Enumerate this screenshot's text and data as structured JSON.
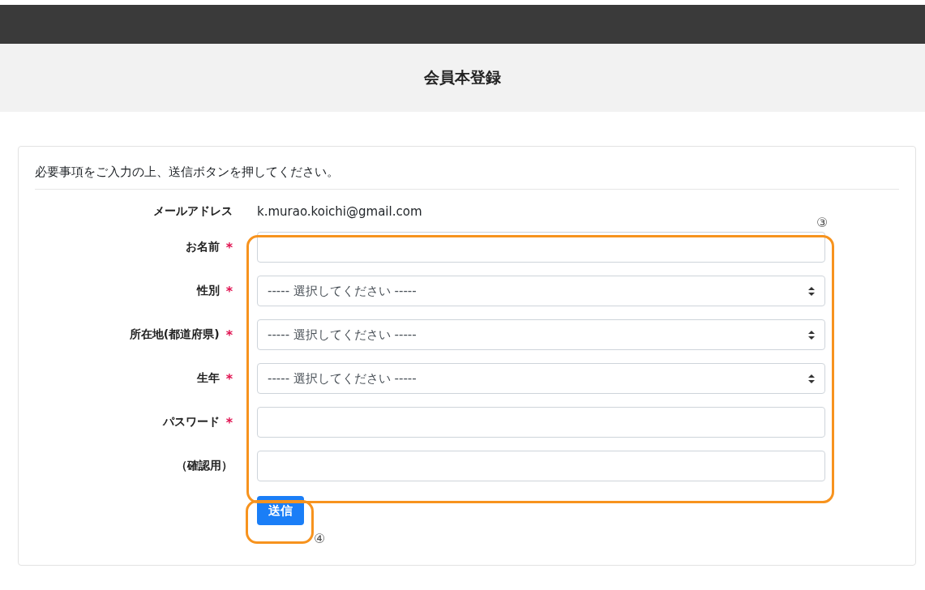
{
  "header": {
    "title": "会員本登録"
  },
  "form": {
    "intro": "必要事項をご入力の上、送信ボタンを押してください。",
    "email": {
      "label": "メールアドレス",
      "value": "k.murao.koichi@gmail.com"
    },
    "fields": [
      {
        "label": "お名前",
        "mark": "*",
        "kind": "input"
      },
      {
        "label": "性別",
        "mark": "*",
        "kind": "select",
        "value": "----- 選択してください -----"
      },
      {
        "label": "所在地(都道府県)",
        "mark": "*",
        "kind": "select",
        "value": "----- 選択してください -----"
      },
      {
        "label": "生年",
        "mark": "*",
        "kind": "select",
        "value": "----- 選択してください -----"
      },
      {
        "label": "パスワード",
        "mark": "*",
        "kind": "input"
      },
      {
        "label": "（確認用）",
        "kind": "input"
      }
    ],
    "submit": "送信"
  },
  "annotations": {
    "fields_group": "③",
    "submit": "④"
  }
}
